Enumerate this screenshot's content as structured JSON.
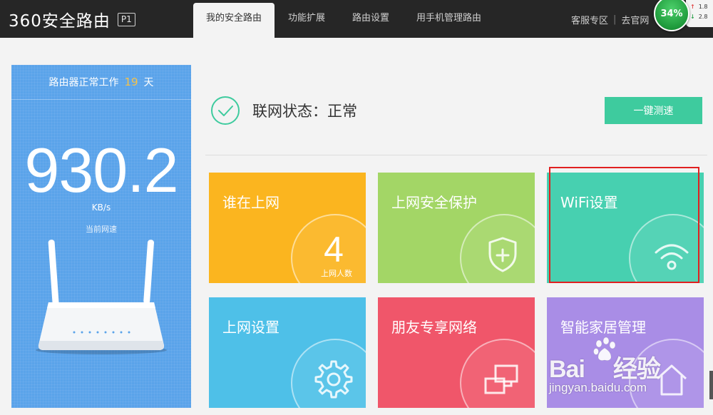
{
  "header": {
    "logo_text": "360安全路由",
    "model_badge": "P1",
    "tabs": [
      {
        "label": "我的安全路由",
        "active": true
      },
      {
        "label": "功能扩展",
        "active": false
      },
      {
        "label": "路由设置",
        "active": false
      },
      {
        "label": "用手机管理路由",
        "active": false
      }
    ],
    "links": {
      "service": "客服专区",
      "official": "去官网"
    },
    "speed_widget": {
      "percent": "34%",
      "up_value": "1.8",
      "down_value": "2.8"
    }
  },
  "left_panel": {
    "uptime_prefix": "路由器正常工作",
    "uptime_days": "19",
    "uptime_suffix": "天",
    "speed_value": "930.2",
    "speed_unit": "KB/s",
    "speed_label": "当前网速"
  },
  "status": {
    "label": "联网状态：正常",
    "test_button": "一键测速"
  },
  "tiles": [
    {
      "title": "谁在上网",
      "count": "4",
      "sub": "上网人数",
      "color": "#fbb51f",
      "icon": "count"
    },
    {
      "title": "上网安全保护",
      "color": "#a3d666",
      "icon": "shield-plus-icon"
    },
    {
      "title": "WiFi设置",
      "color": "#47d0b0",
      "icon": "wifi-icon"
    },
    {
      "title": "上网设置",
      "color": "#4ec0e8",
      "icon": "gear-icon"
    },
    {
      "title": "朋友专享网络",
      "color": "#f0566a",
      "icon": "network-icon"
    },
    {
      "title": "智能家居管理",
      "color": "#a98de6",
      "icon": "home-icon"
    }
  ],
  "watermark": {
    "brand_left": "Bai",
    "brand_right": "经验",
    "url": "jingyan.baidu.com"
  },
  "colors": {
    "topbar": "#262626",
    "panel_blue": "#5aa3ea",
    "accent_green": "#3ecb9e",
    "highlight_red": "#e02020",
    "uptime_days": "#f6c248"
  }
}
